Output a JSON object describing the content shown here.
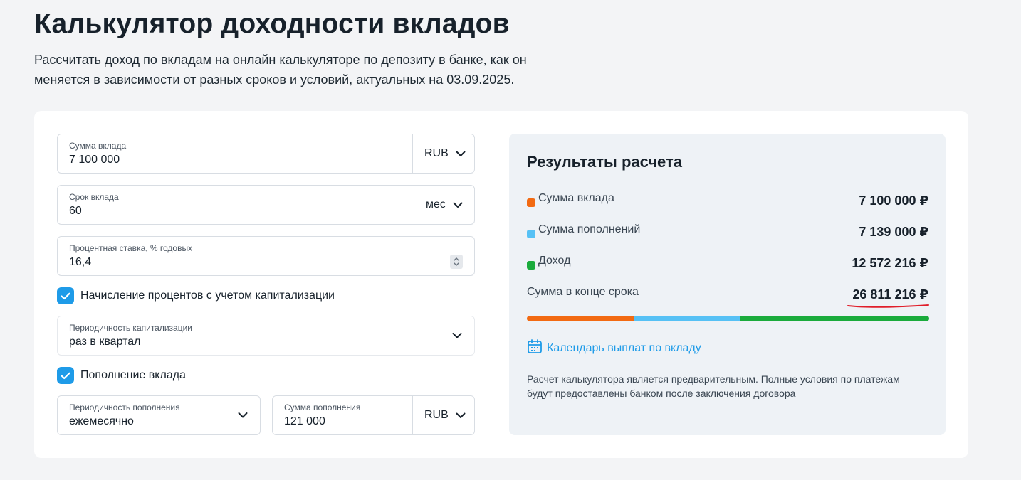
{
  "header": {
    "title": "Калькулятор доходности вкладов",
    "subtitle": "Рассчитать доход по вкладам на онлайн калькуляторе по депозиту в банке, как он меняется в зависимости от разных сроков и условий, актуальных на 03.09.2025."
  },
  "form": {
    "deposit_amount": {
      "label": "Сумма вклада",
      "value": "7 100 000",
      "currency": "RUB"
    },
    "term": {
      "label": "Срок вклада",
      "value": "60",
      "unit": "мес"
    },
    "rate": {
      "label": "Процентная ставка, % годовых",
      "value": "16,4"
    },
    "capitalization_checkbox": {
      "label": "Начисление процентов с учетом капитализации",
      "checked": true
    },
    "capitalization_period": {
      "label": "Периодичность капитализации",
      "value": "раз в квартал"
    },
    "topup_checkbox": {
      "label": "Пополнение вклада",
      "checked": true
    },
    "topup_period": {
      "label": "Периодичность пополнения",
      "value": "ежемесячно"
    },
    "topup_amount": {
      "label": "Сумма пополнения",
      "value": "121 000",
      "currency": "RUB"
    }
  },
  "results": {
    "title": "Результаты расчета",
    "rows": [
      {
        "label": "Сумма вклада",
        "value": "7 100 000 ₽",
        "color": "#f26a12"
      },
      {
        "label": "Сумма пополнений",
        "value": "7 139 000 ₽",
        "color": "#56c1f5"
      },
      {
        "label": "Доход",
        "value": "12 572 216 ₽",
        "color": "#1aab3c"
      }
    ],
    "total": {
      "label": "Сумма в конце срока",
      "value": "26 811 216 ₽",
      "underline_color": "#e01e2a"
    },
    "bar_segments": [
      {
        "name": "deposit",
        "fraction": 0.265,
        "color": "#f26a12"
      },
      {
        "name": "topups",
        "fraction": 0.266,
        "color": "#56c1f5"
      },
      {
        "name": "income",
        "fraction": 0.469,
        "color": "#1aab3c"
      }
    ],
    "calendar_link": {
      "label": "Календарь выплат по вкладу",
      "icon": "calendar-icon"
    },
    "disclaimer": "Расчет калькулятора является предварительным. Полные условия по платежам будут предоставлены банком после заключения договора"
  }
}
